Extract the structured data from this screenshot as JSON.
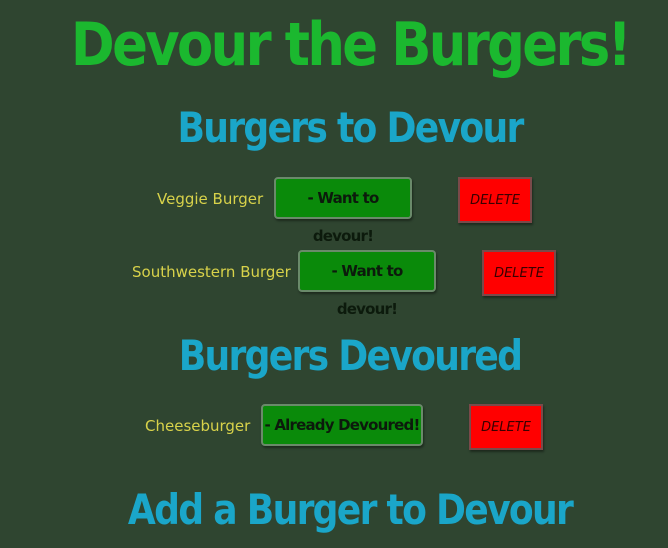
{
  "page": {
    "title": "Devour the Burgers!"
  },
  "sections": {
    "to_devour": {
      "heading": "Burgers to Devour",
      "items": [
        {
          "name": "Veggie Burger",
          "action_label": "- Want to devour!",
          "delete_label": "DELETE"
        },
        {
          "name": "Southwestern Burger",
          "action_label": "- Want to devour!",
          "delete_label": "DELETE"
        }
      ]
    },
    "devoured": {
      "heading": "Burgers Devoured",
      "items": [
        {
          "name": "Cheeseburger",
          "action_label": "- Already Devoured!",
          "delete_label": "DELETE"
        }
      ]
    },
    "add": {
      "heading": "Add a Burger to Devour"
    }
  },
  "colors": {
    "background": "#2f4530",
    "title": "#1bb82f",
    "heading": "#1aa6c9",
    "burger_name": "#d8d24a",
    "action_button": "#0a8a0a",
    "delete_button": "#ff0000"
  }
}
